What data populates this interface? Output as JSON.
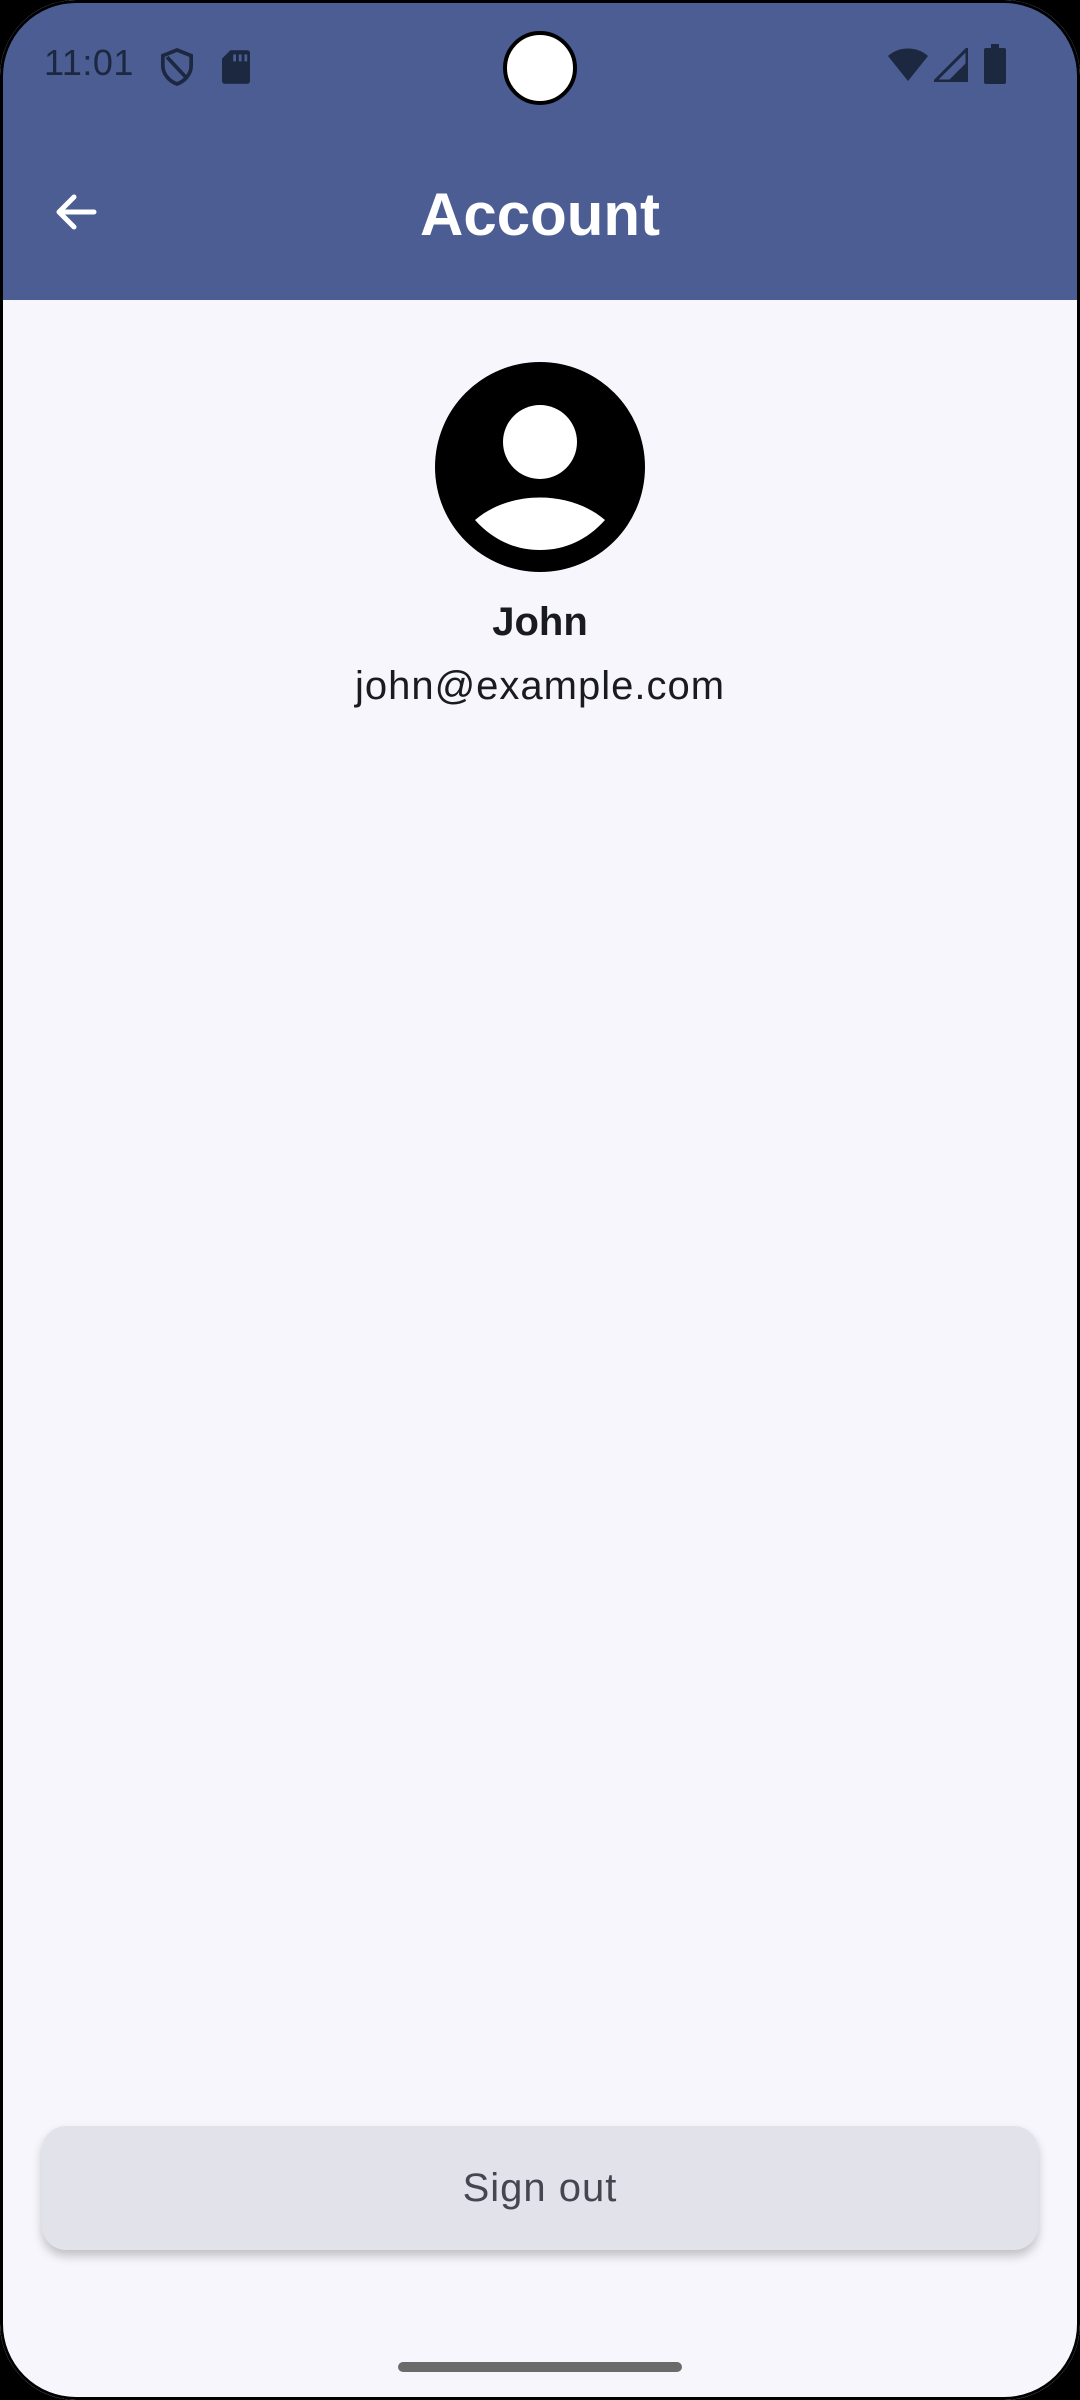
{
  "status_bar": {
    "time": "11:01",
    "icons": [
      "shield-icon",
      "sd-card-icon",
      "wifi-icon",
      "cell-signal-icon",
      "battery-icon"
    ]
  },
  "header": {
    "title": "Account",
    "back_icon": "arrow-back-icon"
  },
  "profile": {
    "avatar_icon": "account-circle-icon",
    "name": "John",
    "email": "john@example.com"
  },
  "actions": {
    "sign_out_label": "Sign out"
  },
  "colors": {
    "header_bg": "#4b5d92",
    "page_bg": "#f6f6fc",
    "button_bg": "#e2e2ea",
    "text_primary": "#1a1b20"
  }
}
